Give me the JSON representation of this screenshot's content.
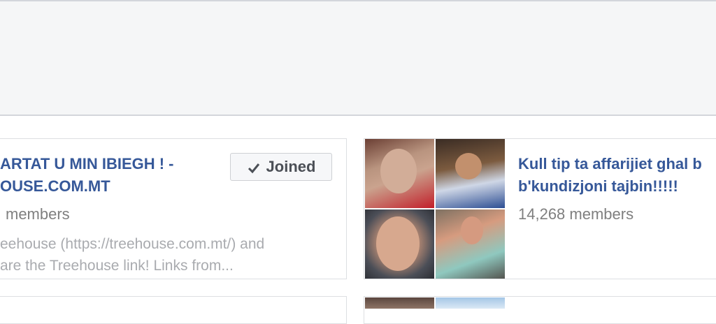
{
  "groups": [
    {
      "title_line1": "ARTAT U MIN IBIEGH ! -",
      "title_line2": "OUSE.COM.MT",
      "members": "members",
      "description_line1": "eehouse (https://treehouse.com.mt/) and",
      "description_line2": "are the Treehouse link! Links from...",
      "action_label": "Joined"
    },
    {
      "title_line1": "Kull tip ta affarijiet ghal b",
      "title_line2": "b'kundizjoni tajbin!!!!!",
      "members": "14,268 members"
    }
  ],
  "icons": {
    "check": "check-icon"
  }
}
